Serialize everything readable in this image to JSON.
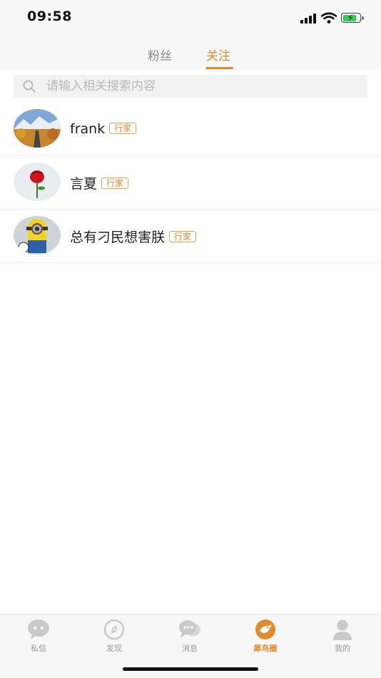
{
  "status_bar": {
    "time": "09:58"
  },
  "tabs": [
    {
      "label": "粉丝",
      "active": false
    },
    {
      "label": "关注",
      "active": true
    }
  ],
  "search": {
    "placeholder": "请输入相关搜索内容",
    "value": ""
  },
  "follow_list": [
    {
      "name": "frank",
      "badge": "行家",
      "avatar": "mountain-road-photo"
    },
    {
      "name": "言夏",
      "badge": "行家",
      "avatar": "red-rose-photo"
    },
    {
      "name": "总有刁民想害朕",
      "badge": "行家",
      "avatar": "minion-photo"
    }
  ],
  "bottom_nav": [
    {
      "label": "私信",
      "icon": "chat-bubble-icon",
      "active": false
    },
    {
      "label": "发现",
      "icon": "compass-icon",
      "active": false
    },
    {
      "label": "消息",
      "icon": "messages-icon",
      "active": false
    },
    {
      "label": "犀鸟圈",
      "icon": "hornbill-circle-icon",
      "active": true
    },
    {
      "label": "我的",
      "icon": "user-icon",
      "active": false
    }
  ],
  "colors": {
    "accent": "#e08b2f",
    "inactive": "#999999",
    "background": "#f7f7f7"
  }
}
